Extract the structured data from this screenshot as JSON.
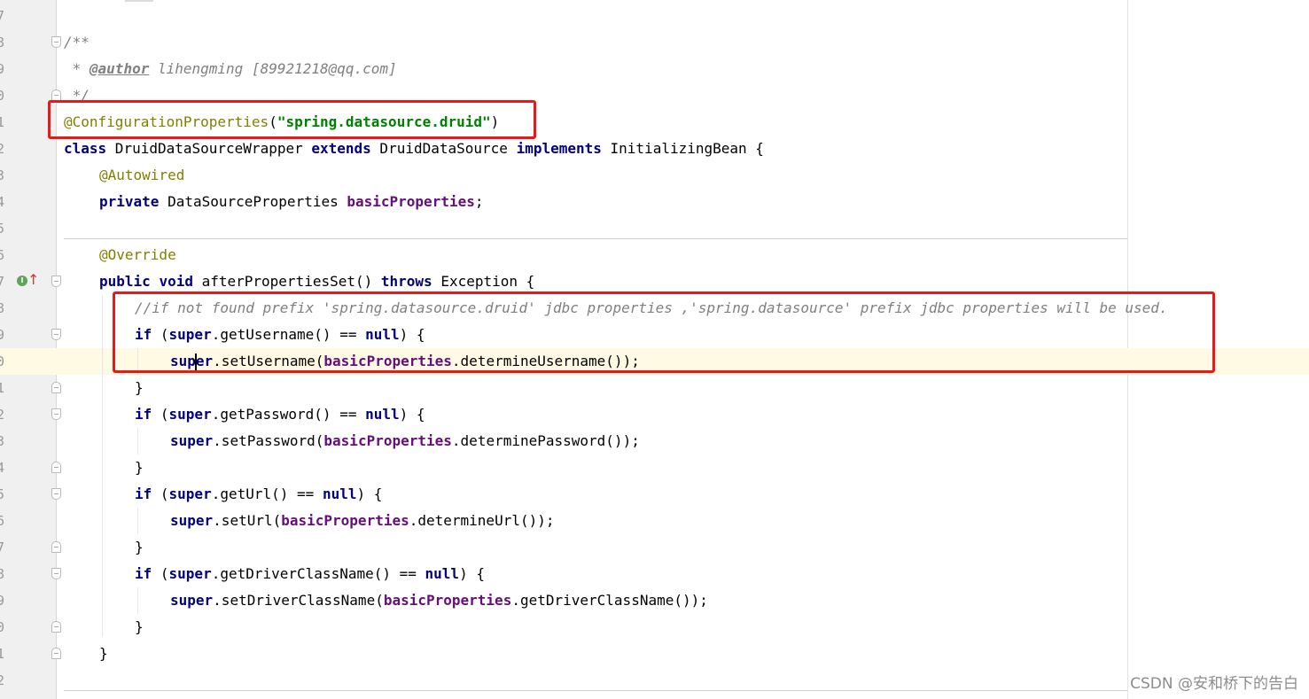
{
  "gutter": {
    "line_numbers": [
      "7",
      "8",
      "9",
      "0",
      "1",
      "2",
      "3",
      "4",
      "5",
      "6",
      "7",
      "8",
      "9",
      "0",
      "1",
      "2",
      "3",
      "4",
      "5",
      "6",
      "7",
      "8",
      "9",
      "0",
      "1",
      "2"
    ],
    "icons": [
      "override-implements-icon",
      "up-arrow-icon"
    ]
  },
  "code": {
    "javadoc_open": "/**",
    "javadoc_star": " * ",
    "javadoc_tag": "@author",
    "javadoc_author": " lihengming [89921218@qq.com]",
    "javadoc_close": " */",
    "annotation": "@ConfigurationProperties",
    "annotation_paren_open": "(",
    "annotation_value": "\"spring.datasource.druid\"",
    "annotation_paren_close": ")",
    "kw_class": "class",
    "class_name": " DruidDataSourceWrapper ",
    "kw_extends": "extends",
    "parent_class": " DruidDataSource ",
    "kw_implements": "implements",
    "interface_name": " InitializingBean {",
    "autowired": "@Autowired",
    "kw_private": "private",
    "field_type": " DataSourceProperties ",
    "field_name": "basicProperties",
    "semicolon": ";",
    "override": "@Override",
    "kw_public": "public",
    "kw_void": "void",
    "method_name": " afterPropertiesSet() ",
    "kw_throws": "throws",
    "exception": " Exception {",
    "comment": "//if not found prefix 'spring.datasource.druid' jdbc properties ,'spring.datasource' prefix jdbc properties will be used.",
    "kw_if": "if",
    "kw_super": "super",
    "kw_null": "null",
    "get_username": ".getUsername() == ",
    "set_username": ".setUsername(",
    "determine_username": ".determineUsername());",
    "get_password": ".getPassword() == ",
    "set_password": ".setPassword(",
    "determine_password": ".determinePassword());",
    "get_url": ".getUrl() == ",
    "set_url": ".setUrl(",
    "determine_url": ".determineUrl());",
    "get_driver": ".getDriverClassName() == ",
    "set_driver": ".setDriverClassName(",
    "get_driver_call": ".getDriverClassName());",
    "paren_open": " (",
    "if_close": ") {",
    "close_brace": "}",
    "caret_split_a": "sup",
    "caret_split_b": "er"
  },
  "watermark": "CSDN @安和桥下的告白",
  "colors": {
    "keyword": "#000080",
    "annotation": "#808000",
    "string": "#008000",
    "field": "#660e7a",
    "comment": "#808080",
    "highlight_box": "#e8191a",
    "current_line": "#fffae3"
  }
}
